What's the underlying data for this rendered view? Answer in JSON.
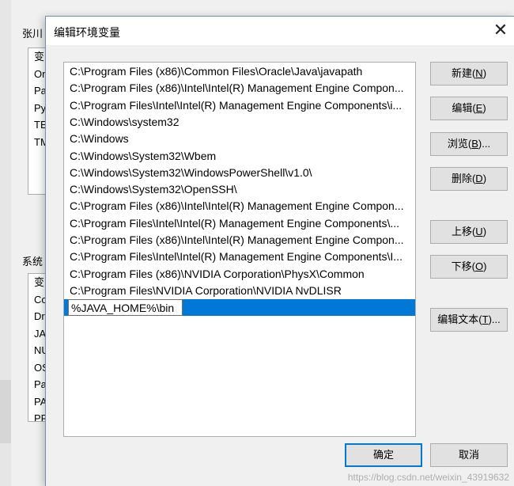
{
  "background_window": {
    "user_group_label": "张川",
    "user_vars": [
      "变",
      "On",
      "Pa",
      "Py",
      "TE",
      "TM"
    ],
    "system_group_label": "系统",
    "system_vars": [
      "变",
      "Co",
      "Dr",
      "JA",
      "NU",
      "OS",
      "Pa",
      "PA",
      "PR"
    ]
  },
  "dialog": {
    "title": "编辑环境变量",
    "close_glyph": "✕",
    "paths": [
      "C:\\Program Files (x86)\\Common Files\\Oracle\\Java\\javapath",
      "C:\\Program Files (x86)\\Intel\\Intel(R) Management Engine Compon...",
      "C:\\Program Files\\Intel\\Intel(R) Management Engine Components\\i...",
      "C:\\Windows\\system32",
      "C:\\Windows",
      "C:\\Windows\\System32\\Wbem",
      "C:\\Windows\\System32\\WindowsPowerShell\\v1.0\\",
      "C:\\Windows\\System32\\OpenSSH\\",
      "C:\\Program Files (x86)\\Intel\\Intel(R) Management Engine Compon...",
      "C:\\Program Files\\Intel\\Intel(R) Management Engine Components\\...",
      "C:\\Program Files (x86)\\Intel\\Intel(R) Management Engine Compon...",
      "C:\\Program Files\\Intel\\Intel(R) Management Engine Components\\I...",
      "C:\\Program Files (x86)\\NVIDIA Corporation\\PhysX\\Common",
      "C:\\Program Files\\NVIDIA Corporation\\NVIDIA NvDLISR"
    ],
    "editing_value": "%JAVA_HOME%\\bin",
    "buttons": {
      "new": {
        "label": "新建(",
        "key": "N",
        "end": ")"
      },
      "edit": {
        "label": "编辑(",
        "key": "E",
        "end": ")"
      },
      "browse": {
        "label": "浏览(",
        "key": "B",
        "end": ")..."
      },
      "delete": {
        "label": "删除(",
        "key": "D",
        "end": ")"
      },
      "move_up": {
        "label": "上移(",
        "key": "U",
        "end": ")"
      },
      "move_down": {
        "label": "下移(",
        "key": "O",
        "end": ")"
      },
      "edit_text": {
        "label": "编辑文本(",
        "key": "T",
        "end": ")..."
      }
    },
    "ok_label": "确定",
    "cancel_label": "取消"
  },
  "watermark": "https://blog.csdn.net/weixin_43919632",
  "colors": {
    "selection": "#0078d7",
    "button_bg": "#e1e1e1",
    "dialog_bg": "#f0f0f0"
  }
}
